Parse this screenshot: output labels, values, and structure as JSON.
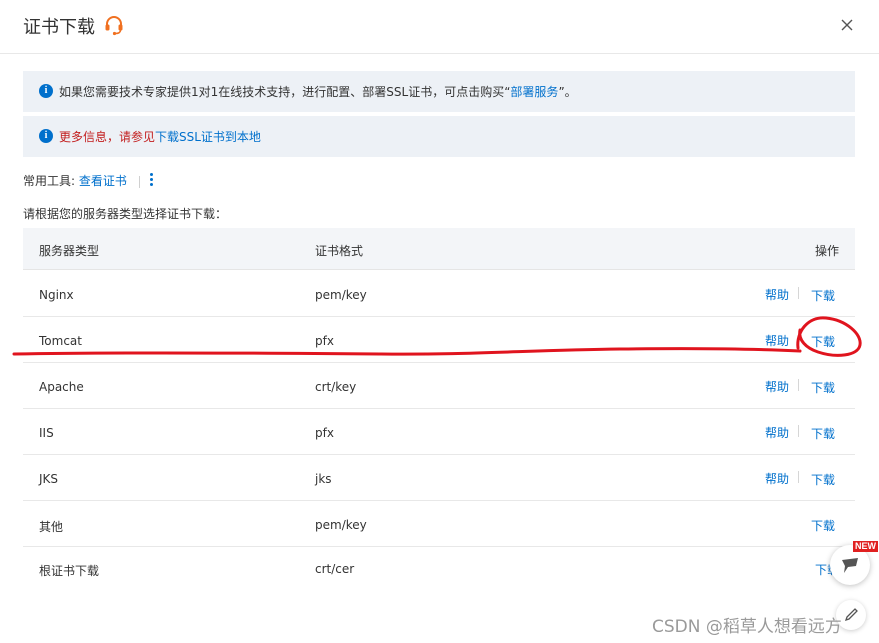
{
  "dialog": {
    "title": "证书下载",
    "close_icon": "close-icon",
    "support_icon": "headset-support-icon"
  },
  "notices": [
    {
      "icon": "info-icon",
      "text": "如果您需要技术专家提供1对1在线技术支持，进行配置、部署SSL证书，可点击购买“",
      "link": "部署服务",
      "suffix": "”。"
    },
    {
      "icon": "info-icon",
      "text": "更多信息，请参见",
      "link": "下载SSL证书到本地"
    }
  ],
  "tools": {
    "label": "常用工具:",
    "link": "查看证书",
    "more_icon": "more-vertical-icon"
  },
  "hint": "请根据您的服务器类型选择证书下载：",
  "table": {
    "headers": [
      "服务器类型",
      "证书格式",
      "操作"
    ],
    "rows": [
      {
        "server": "Nginx",
        "format": "pem/key",
        "help": "帮助",
        "download": "下载"
      },
      {
        "server": "Tomcat",
        "format": "pfx",
        "help": "帮助",
        "download": "下载"
      },
      {
        "server": "Apache",
        "format": "crt/key",
        "help": "帮助",
        "download": "下载"
      },
      {
        "server": "IIS",
        "format": "pfx",
        "help": "帮助",
        "download": "下载"
      },
      {
        "server": "JKS",
        "format": "jks",
        "help": "帮助",
        "download": "下载"
      },
      {
        "server": "其他",
        "format": "pem/key",
        "help": "",
        "download": "下载"
      },
      {
        "server": "根证书下载",
        "format": "crt/cer",
        "help": "",
        "download": "下载"
      }
    ]
  },
  "floating": {
    "badge": "NEW",
    "feedback_icon": "feedback-icon",
    "edit_icon": "edit-pen-icon"
  },
  "watermark": "CSDN @稻草人想看远方",
  "colors": {
    "link": "#0070cc",
    "alert_text": "#c21d1d",
    "notice_bg": "#edf1f6",
    "annotation": "#e0141e",
    "support_icon": "#f07020"
  }
}
